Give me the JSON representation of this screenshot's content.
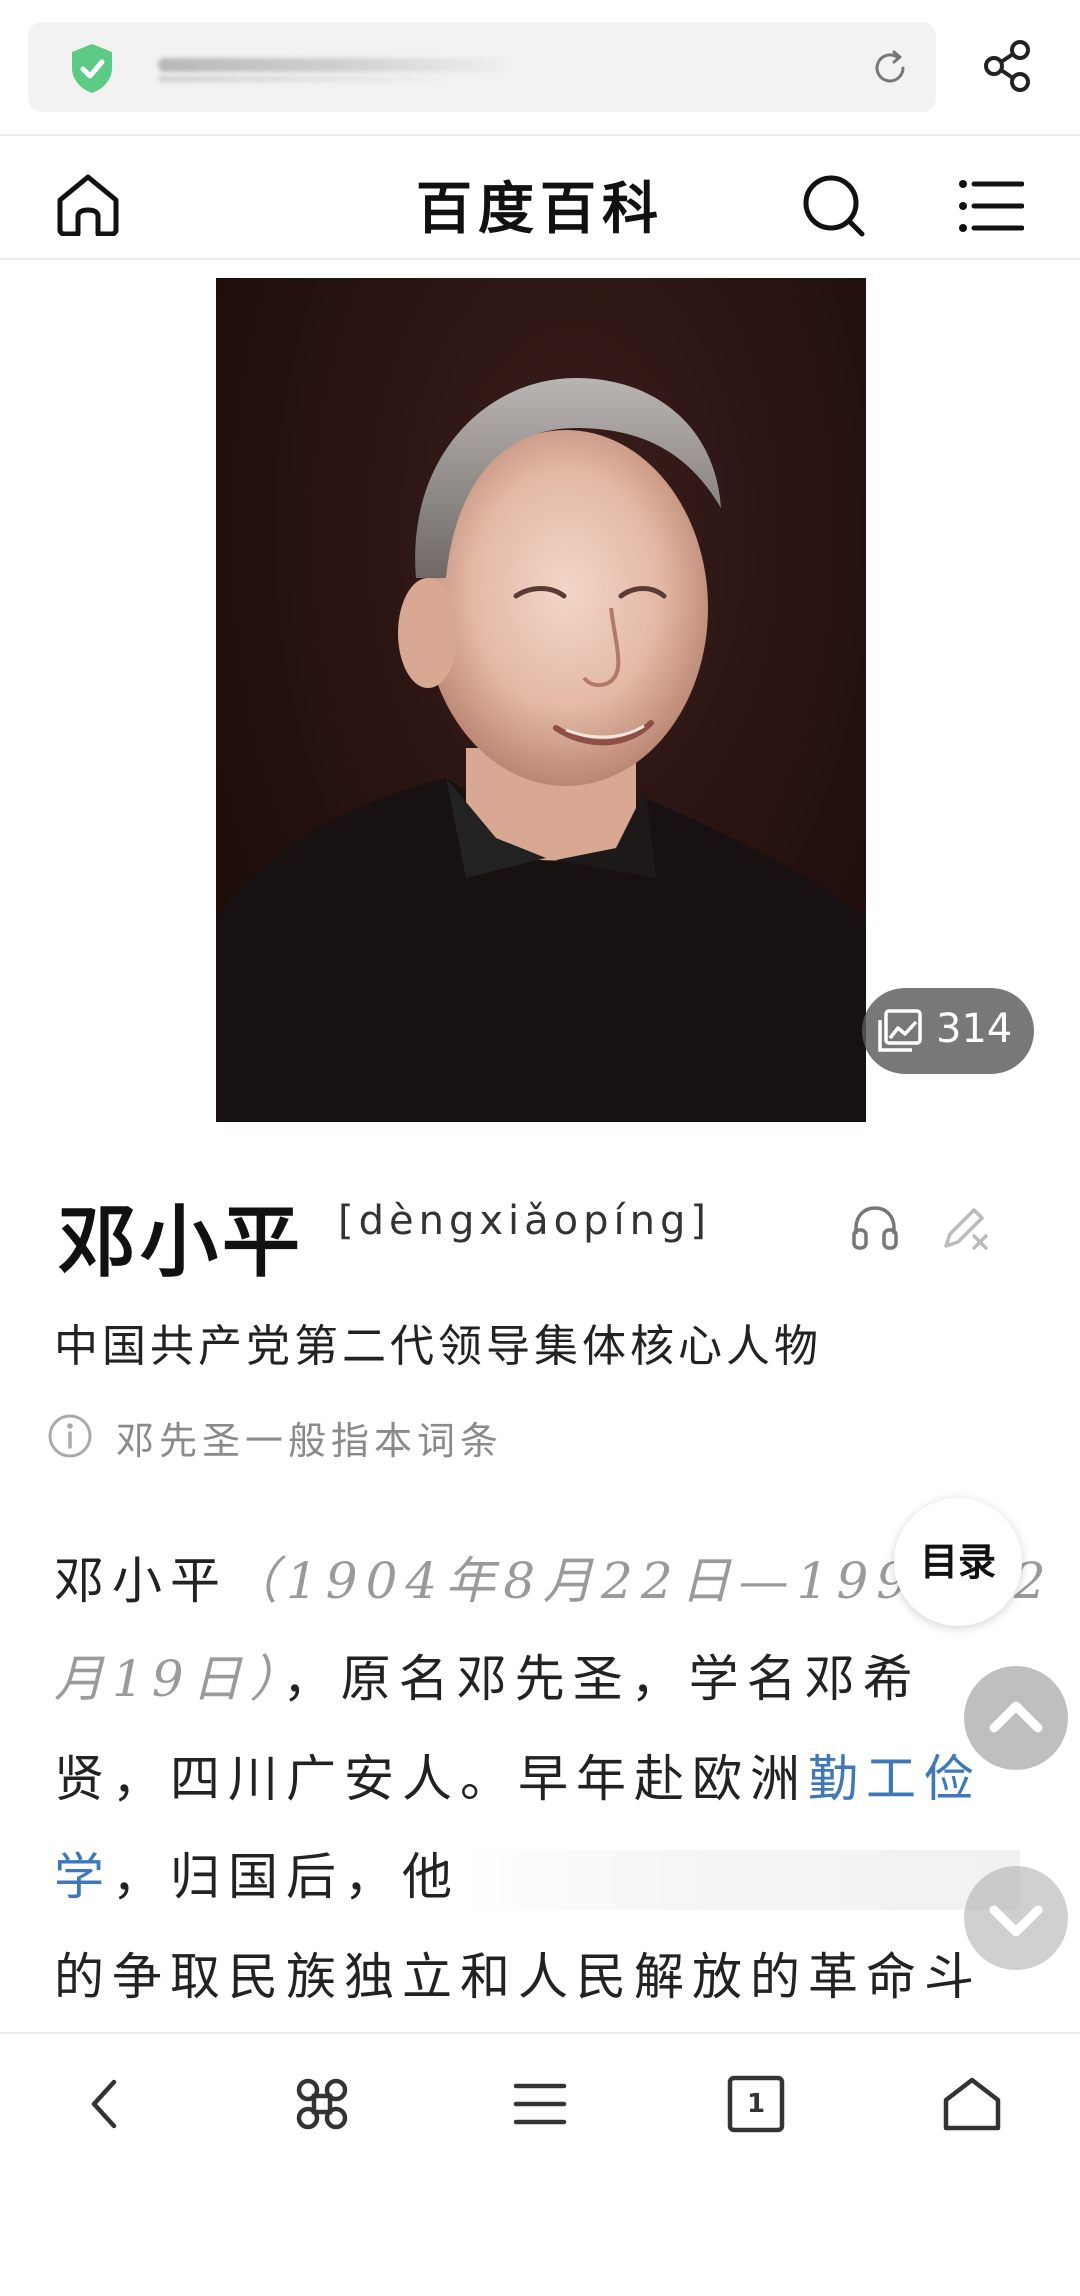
{
  "browser": {
    "share_icon": "share-icon",
    "reload_icon": "reload-icon",
    "security_icon": "shield-check-icon",
    "accent_green": "#4cc27a"
  },
  "header": {
    "site_title": "百度百科"
  },
  "article": {
    "gallery_count": "314",
    "title": "邓小平",
    "pinyin": "[dèngxiǎopíng]",
    "subtitle": "中国共产党第二代领导集体核心人物",
    "disambiguation": "邓先圣一般指本词条",
    "paragraph": {
      "l1_name": "邓小平",
      "l1_dates": "（1904年8月22日—1997年2",
      "l2_dates": "月19日）",
      "l2_rest": "，原名邓先圣，学名邓希",
      "l3_text": "贤，四川广安人。早年赴欧洲",
      "l3_link": "勤工俭",
      "l4_link": "学",
      "l4_rest": "，归国后，他",
      "l5_text": "的争取民族独立和人民解放的革命斗"
    },
    "link_color": "#3e78b8"
  },
  "floating": {
    "toc_label": "目录"
  },
  "toolbar": {
    "tab_count": "1"
  }
}
